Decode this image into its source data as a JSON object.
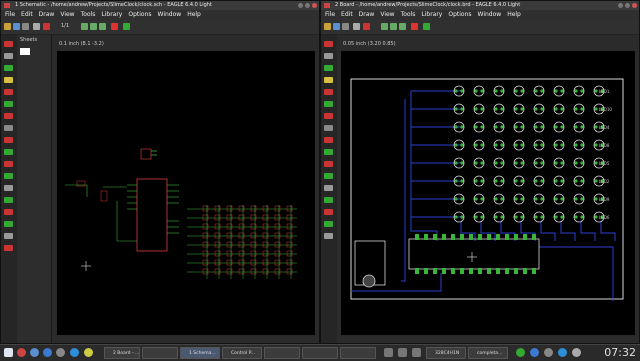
{
  "left_window": {
    "title": "1 Schematic - /home/andrew/Projects/SlimeClock/clock.sch - EAGLE 6.4.0 Light",
    "menu": [
      "File",
      "Edit",
      "Draw",
      "View",
      "Tools",
      "Library",
      "Options",
      "Window",
      "Help"
    ],
    "sheets_label": "Sheets",
    "grid_readout": "0.1 inch (8.1 -3.2)",
    "page_selector": "1/1"
  },
  "right_window": {
    "title": "2 Board - /home/andrew/Projects/SlimeClock/clock.brd - EAGLE 6.4.0 Light",
    "menu": [
      "File",
      "Edit",
      "Draw",
      "View",
      "Tools",
      "Library",
      "Options",
      "Window",
      "Help"
    ],
    "grid_readout": "0.05 inch (3.20 0.85)",
    "led_labels": [
      "LED1",
      "LED10",
      "LED4",
      "LED8",
      "LED5",
      "LED2",
      "LED9",
      "LED6"
    ]
  },
  "taskbar": {
    "tasks": [
      {
        "label": "2 Board - ...",
        "active": false
      },
      {
        "label": "",
        "active": false
      },
      {
        "label": "1 Schema...",
        "active": true
      },
      {
        "label": "Control P...",
        "active": false
      },
      {
        "label": "",
        "active": false
      },
      {
        "label": "",
        "active": false
      },
      {
        "label": "",
        "active": false
      },
      {
        "label": "328C4H1N",
        "active": false
      },
      {
        "label": "completa...",
        "active": false
      }
    ],
    "clock": "07:32"
  },
  "colors": {
    "schematic_wire": "#3ab53a",
    "schematic_part": "#b03030",
    "board_trace": "#2a3fd0",
    "board_pad": "#3ab53a",
    "board_outline": "#d8d8d8"
  }
}
